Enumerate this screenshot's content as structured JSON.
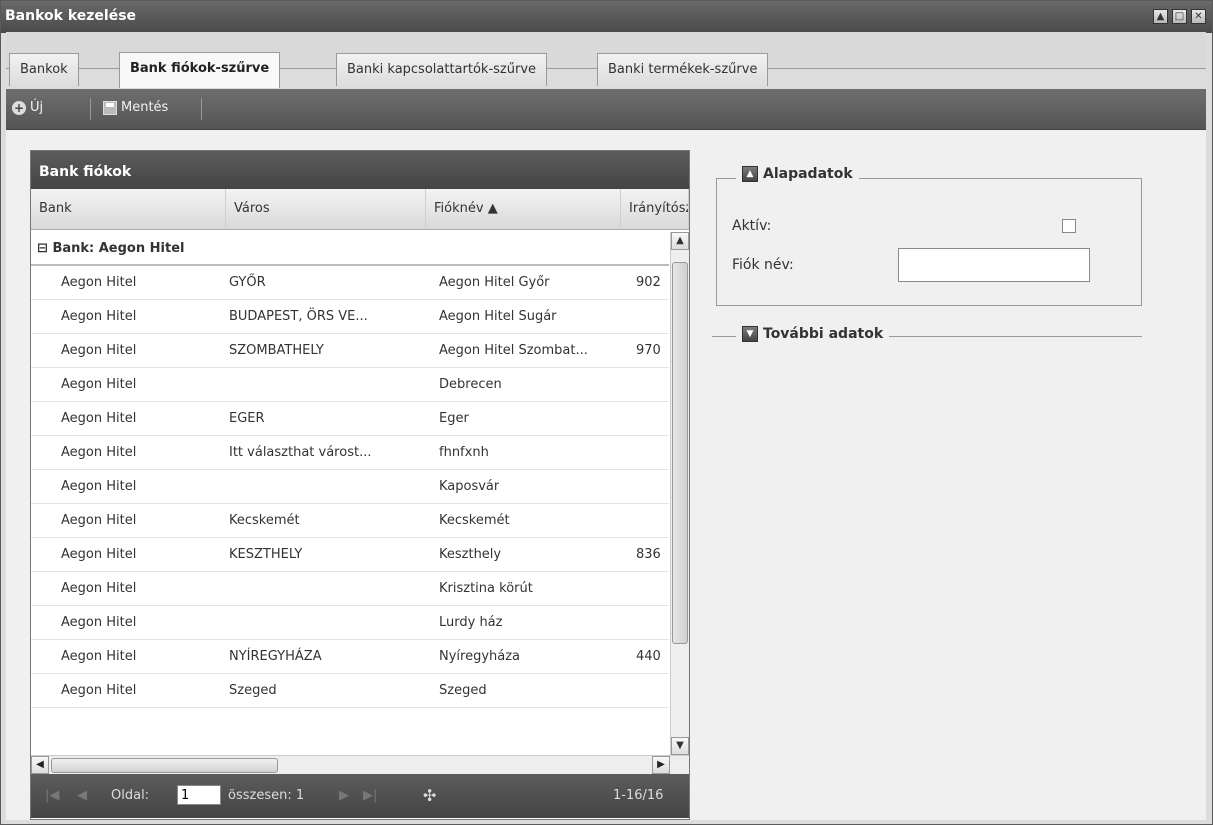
{
  "window": {
    "title": "Bankok kezelése"
  },
  "tabs": [
    {
      "label": "Bankok"
    },
    {
      "label": "Bank fiókok-szűrve"
    },
    {
      "label": "Banki kapcsolattartók-szűrve"
    },
    {
      "label": "Banki termékek-szűrve"
    }
  ],
  "toolbar": {
    "new_label": "Új",
    "save_label": "Mentés",
    "new_icon": "plus-circle-icon",
    "save_icon": "floppy-disk-icon"
  },
  "grid": {
    "title": "Bank fiókok",
    "columns": [
      "Bank",
      "Város",
      "Fióknév ▲",
      "Irányítószám"
    ],
    "group_label": "Bank: Aegon Hitel",
    "rows": [
      [
        "Aegon Hitel",
        "GYŐR",
        "Aegon Hitel Győr",
        "902"
      ],
      [
        "Aegon Hitel",
        "BUDAPEST, ÖRS VE...",
        "Aegon Hitel Sugár",
        ""
      ],
      [
        "Aegon Hitel",
        "SZOMBATHELY",
        "Aegon Hitel Szombat...",
        "970"
      ],
      [
        "Aegon Hitel",
        "",
        "Debrecen",
        ""
      ],
      [
        "Aegon Hitel",
        "EGER",
        "Eger",
        ""
      ],
      [
        "Aegon Hitel",
        "Itt választhat várost...",
        "fhnfxnh",
        ""
      ],
      [
        "Aegon Hitel",
        "",
        "Kaposvár",
        ""
      ],
      [
        "Aegon Hitel",
        "Kecskemét",
        "Kecskemét",
        ""
      ],
      [
        "Aegon Hitel",
        "KESZTHELY",
        "Keszthely",
        "836"
      ],
      [
        "Aegon Hitel",
        "",
        "Krisztina körút",
        ""
      ],
      [
        "Aegon Hitel",
        "",
        "Lurdy ház",
        ""
      ],
      [
        "Aegon Hitel",
        "NYÍREGYHÁZA",
        "Nyíregyháza",
        "440"
      ],
      [
        "Aegon Hitel",
        "Szeged",
        "Szeged",
        ""
      ]
    ],
    "pager": {
      "page_label": "Oldal:",
      "page_value": "1",
      "total_label": "összesen: 1",
      "range_label": "1-16/16"
    }
  },
  "form": {
    "basic_legend": "Alapadatok",
    "active_label": "Aktív:",
    "branch_name_label": "Fiók név:",
    "branch_name_value": "",
    "more_legend": "További adatok"
  }
}
